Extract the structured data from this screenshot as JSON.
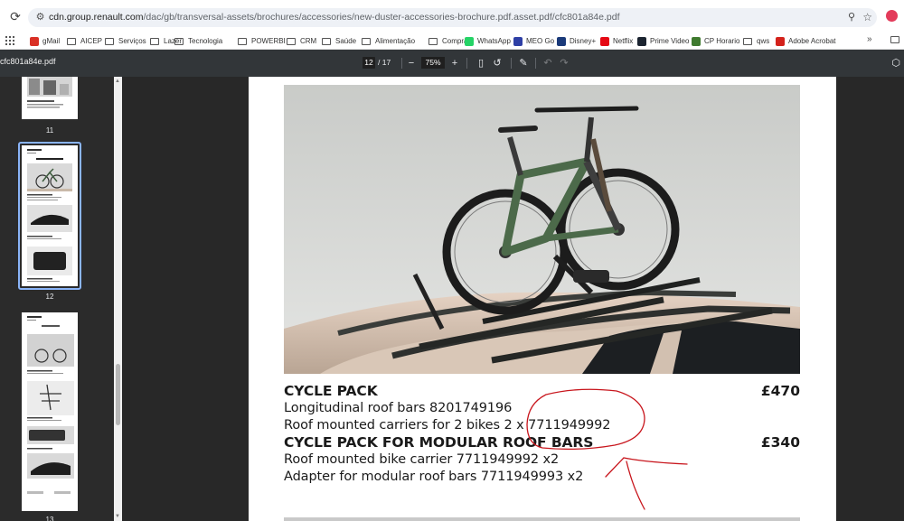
{
  "browser": {
    "url_host": "cdn.group.renault.com",
    "url_path": "/dac/gb/transversal-assets/brochures/accessories/new-duster-accessories-brochure.pdf.asset.pdf/cfc801a84e.pdf",
    "bookmarks": [
      {
        "label": "gMail",
        "icon": "gmail-icon"
      },
      {
        "label": "AICEP",
        "icon": "folder-icon"
      },
      {
        "label": "Serviços",
        "icon": "folder-icon"
      },
      {
        "label": "Lazer",
        "icon": "folder-icon"
      },
      {
        "label": "Tecnologia",
        "icon": "folder-icon"
      },
      {
        "label": "POWERBI",
        "icon": "folder-icon"
      },
      {
        "label": "CRM",
        "icon": "folder-icon"
      },
      {
        "label": "Saúde",
        "icon": "folder-icon"
      },
      {
        "label": "Alimentação",
        "icon": "folder-icon"
      },
      {
        "label": "Compras",
        "icon": "folder-icon"
      },
      {
        "label": "WhatsApp",
        "icon": "whatsapp-icon"
      },
      {
        "label": "MEO Go",
        "icon": "meo-icon"
      },
      {
        "label": "Disney+",
        "icon": "disney-icon"
      },
      {
        "label": "Netflix",
        "icon": "netflix-icon"
      },
      {
        "label": "Prime Video",
        "icon": "prime-video-icon"
      },
      {
        "label": "CP Horario",
        "icon": "cp-icon"
      },
      {
        "label": "qws",
        "icon": "folder-icon"
      },
      {
        "label": "Adobe Acrobat",
        "icon": "acrobat-icon"
      }
    ],
    "bookmark_more": "»"
  },
  "pdf_toolbar": {
    "title": "cfc801a84e.pdf",
    "current_page": "12",
    "total_pages": "/ 17",
    "zoom": "75%"
  },
  "thumbnails": [
    {
      "label": "11"
    },
    {
      "label": "12",
      "selected": true
    },
    {
      "label": "13"
    }
  ],
  "product": {
    "items": [
      {
        "text": "CYCLE PACK",
        "price": "£470",
        "heading": true
      },
      {
        "text": "Longitudinal roof bars  8201749196",
        "price": "",
        "heading": false
      },
      {
        "text": "Roof mounted carriers for 2 bikes  2 x 7711949992",
        "price": "",
        "heading": false
      },
      {
        "text": "CYCLE PACK FOR MODULAR ROOF BARS",
        "price": "£340",
        "heading": true
      },
      {
        "text": "Roof mounted bike carrier 7711949992 x2",
        "price": "",
        "heading": false
      },
      {
        "text": "Adapter for modular roof bars 7711949993 x2",
        "price": "",
        "heading": false
      }
    ]
  },
  "colors": {
    "annotation_red": "#c8161d",
    "toolbar_bg": "#323639",
    "selection_blue": "#8ab4f8"
  }
}
